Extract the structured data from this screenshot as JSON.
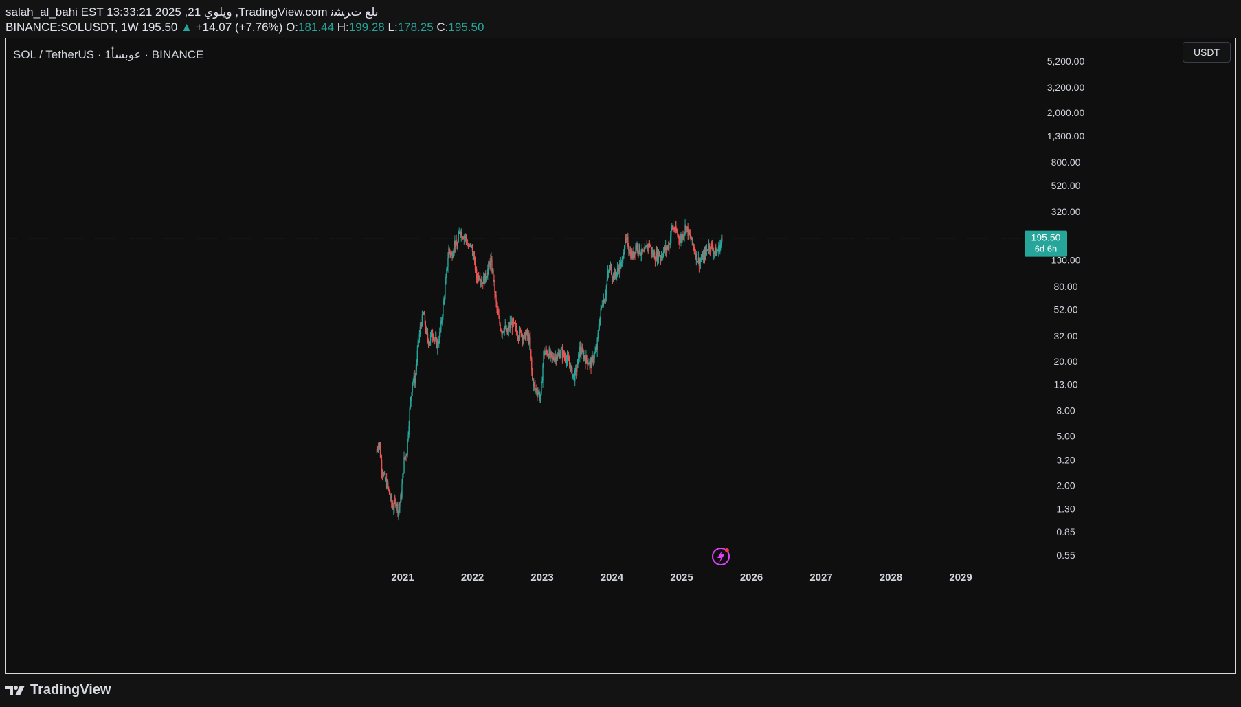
{
  "header": {
    "line1": "salah_al_bahi EST 13:33:21 2025 ,21 ويلوي ,TradingView.com ىلع تﺮﺸﻧ",
    "symbol": "BINANCE:SOLUSDT, 1W",
    "last": "195.50",
    "change_arrow": "▲",
    "change": "+14.07 (+7.76%)",
    "o_label": "O:",
    "o": "181.44",
    "h_label": "H:",
    "h": "199.28",
    "l_label": "L:",
    "l": "178.25",
    "c_label": "C:",
    "c": "195.50"
  },
  "legend": "SOL / TetherUS · 1عوبسأ · BINANCE",
  "unit_button": "USDT",
  "price_label": {
    "price": "195.50",
    "countdown": "6d 6h"
  },
  "footer": {
    "brand": "TradingView"
  },
  "colors": {
    "up": "#26a69a",
    "down": "#ef5350",
    "background": "#0f0f0f",
    "event_icon": "#e040fb"
  },
  "event_icon": "lightning-icon",
  "chart_data": {
    "type": "candlestick",
    "interval": "1W",
    "yscale": "log",
    "ylim": [
      0.45,
      6000
    ],
    "y_ticks": [
      "5,200.00",
      "3,200.00",
      "2,000.00",
      "1,300.00",
      "800.00",
      "520.00",
      "320.00",
      "130.00",
      "80.00",
      "52.00",
      "32.00",
      "20.00",
      "13.00",
      "8.00",
      "5.00",
      "3.20",
      "2.00",
      "1.30",
      "0.85",
      "0.55"
    ],
    "x_ticks": [
      "2021",
      "2022",
      "2023",
      "2024",
      "2025",
      "2026",
      "2027",
      "2028",
      "2029"
    ],
    "x_range": [
      2016.8,
      2030.3
    ],
    "last_price": 195.5,
    "close_path": [
      [
        2020.62,
        3.8
      ],
      [
        2020.66,
        4.5
      ],
      [
        2020.7,
        2.8
      ],
      [
        2020.74,
        2.3
      ],
      [
        2020.78,
        2.0
      ],
      [
        2020.82,
        1.6
      ],
      [
        2020.86,
        1.35
      ],
      [
        2020.9,
        1.5
      ],
      [
        2020.94,
        1.25
      ],
      [
        2020.98,
        1.7
      ],
      [
        2021.02,
        3.2
      ],
      [
        2021.06,
        3.8
      ],
      [
        2021.1,
        8.0
      ],
      [
        2021.14,
        14.0
      ],
      [
        2021.18,
        14.5
      ],
      [
        2021.22,
        27.0
      ],
      [
        2021.26,
        40.0
      ],
      [
        2021.3,
        48.0
      ],
      [
        2021.34,
        33.0
      ],
      [
        2021.38,
        28.0
      ],
      [
        2021.42,
        35.0
      ],
      [
        2021.46,
        30.0
      ],
      [
        2021.5,
        27.0
      ],
      [
        2021.54,
        35.0
      ],
      [
        2021.58,
        55.0
      ],
      [
        2021.62,
        90.0
      ],
      [
        2021.66,
        160.0
      ],
      [
        2021.7,
        140.0
      ],
      [
        2021.74,
        180.0
      ],
      [
        2021.78,
        165.0
      ],
      [
        2021.82,
        230.0
      ],
      [
        2021.86,
        210.0
      ],
      [
        2021.9,
        200.0
      ],
      [
        2021.94,
        165.0
      ],
      [
        2021.98,
        170.0
      ],
      [
        2022.02,
        135.0
      ],
      [
        2022.06,
        95.0
      ],
      [
        2022.1,
        100.0
      ],
      [
        2022.14,
        88.0
      ],
      [
        2022.18,
        93.0
      ],
      [
        2022.22,
        110.0
      ],
      [
        2022.26,
        130.0
      ],
      [
        2022.3,
        95.0
      ],
      [
        2022.34,
        58.0
      ],
      [
        2022.38,
        42.0
      ],
      [
        2022.42,
        35.0
      ],
      [
        2022.46,
        38.0
      ],
      [
        2022.5,
        33.0
      ],
      [
        2022.54,
        40.0
      ],
      [
        2022.58,
        40.0
      ],
      [
        2022.62,
        36.0
      ],
      [
        2022.66,
        33.0
      ],
      [
        2022.7,
        34.0
      ],
      [
        2022.74,
        31.0
      ],
      [
        2022.78,
        33.0
      ],
      [
        2022.82,
        29.0
      ],
      [
        2022.86,
        14.0
      ],
      [
        2022.9,
        12.0
      ],
      [
        2022.94,
        11.5
      ],
      [
        2022.98,
        10.0
      ],
      [
        2023.02,
        23.0
      ],
      [
        2023.06,
        24.0
      ],
      [
        2023.1,
        23.0
      ],
      [
        2023.14,
        21.0
      ],
      [
        2023.18,
        22.0
      ],
      [
        2023.22,
        21.5
      ],
      [
        2023.26,
        24.0
      ],
      [
        2023.3,
        22.5
      ],
      [
        2023.34,
        21.0
      ],
      [
        2023.38,
        20.0
      ],
      [
        2023.42,
        16.5
      ],
      [
        2023.46,
        15.0
      ],
      [
        2023.5,
        18.0
      ],
      [
        2023.54,
        25.0
      ],
      [
        2023.58,
        23.0
      ],
      [
        2023.62,
        21.0
      ],
      [
        2023.66,
        20.0
      ],
      [
        2023.7,
        19.0
      ],
      [
        2023.74,
        22.0
      ],
      [
        2023.78,
        25.0
      ],
      [
        2023.82,
        42.0
      ],
      [
        2023.86,
        60.0
      ],
      [
        2023.9,
        65.0
      ],
      [
        2023.94,
        100.0
      ],
      [
        2023.98,
        115.0
      ],
      [
        2024.02,
        95.0
      ],
      [
        2024.06,
        100.0
      ],
      [
        2024.1,
        115.0
      ],
      [
        2024.14,
        120.0
      ],
      [
        2024.18,
        180.0
      ],
      [
        2024.22,
        185.0
      ],
      [
        2024.26,
        150.0
      ],
      [
        2024.3,
        140.0
      ],
      [
        2024.34,
        170.0
      ],
      [
        2024.38,
        165.0
      ],
      [
        2024.42,
        150.0
      ],
      [
        2024.46,
        145.0
      ],
      [
        2024.5,
        170.0
      ],
      [
        2024.54,
        175.0
      ],
      [
        2024.58,
        150.0
      ],
      [
        2024.62,
        140.0
      ],
      [
        2024.66,
        150.0
      ],
      [
        2024.7,
        140.0
      ],
      [
        2024.74,
        155.0
      ],
      [
        2024.78,
        160.0
      ],
      [
        2024.82,
        175.0
      ],
      [
        2024.86,
        240.0
      ],
      [
        2024.9,
        230.0
      ],
      [
        2024.94,
        210.0
      ],
      [
        2024.98,
        190.0
      ],
      [
        2025.02,
        210.0
      ],
      [
        2025.06,
        250.0
      ],
      [
        2025.1,
        210.0
      ],
      [
        2025.14,
        190.0
      ],
      [
        2025.18,
        160.0
      ],
      [
        2025.22,
        135.0
      ],
      [
        2025.26,
        125.0
      ],
      [
        2025.3,
        140.0
      ],
      [
        2025.34,
        150.0
      ],
      [
        2025.38,
        170.0
      ],
      [
        2025.42,
        170.0
      ],
      [
        2025.46,
        155.0
      ],
      [
        2025.5,
        150.0
      ],
      [
        2025.54,
        165.0
      ],
      [
        2025.58,
        195.5
      ]
    ]
  }
}
